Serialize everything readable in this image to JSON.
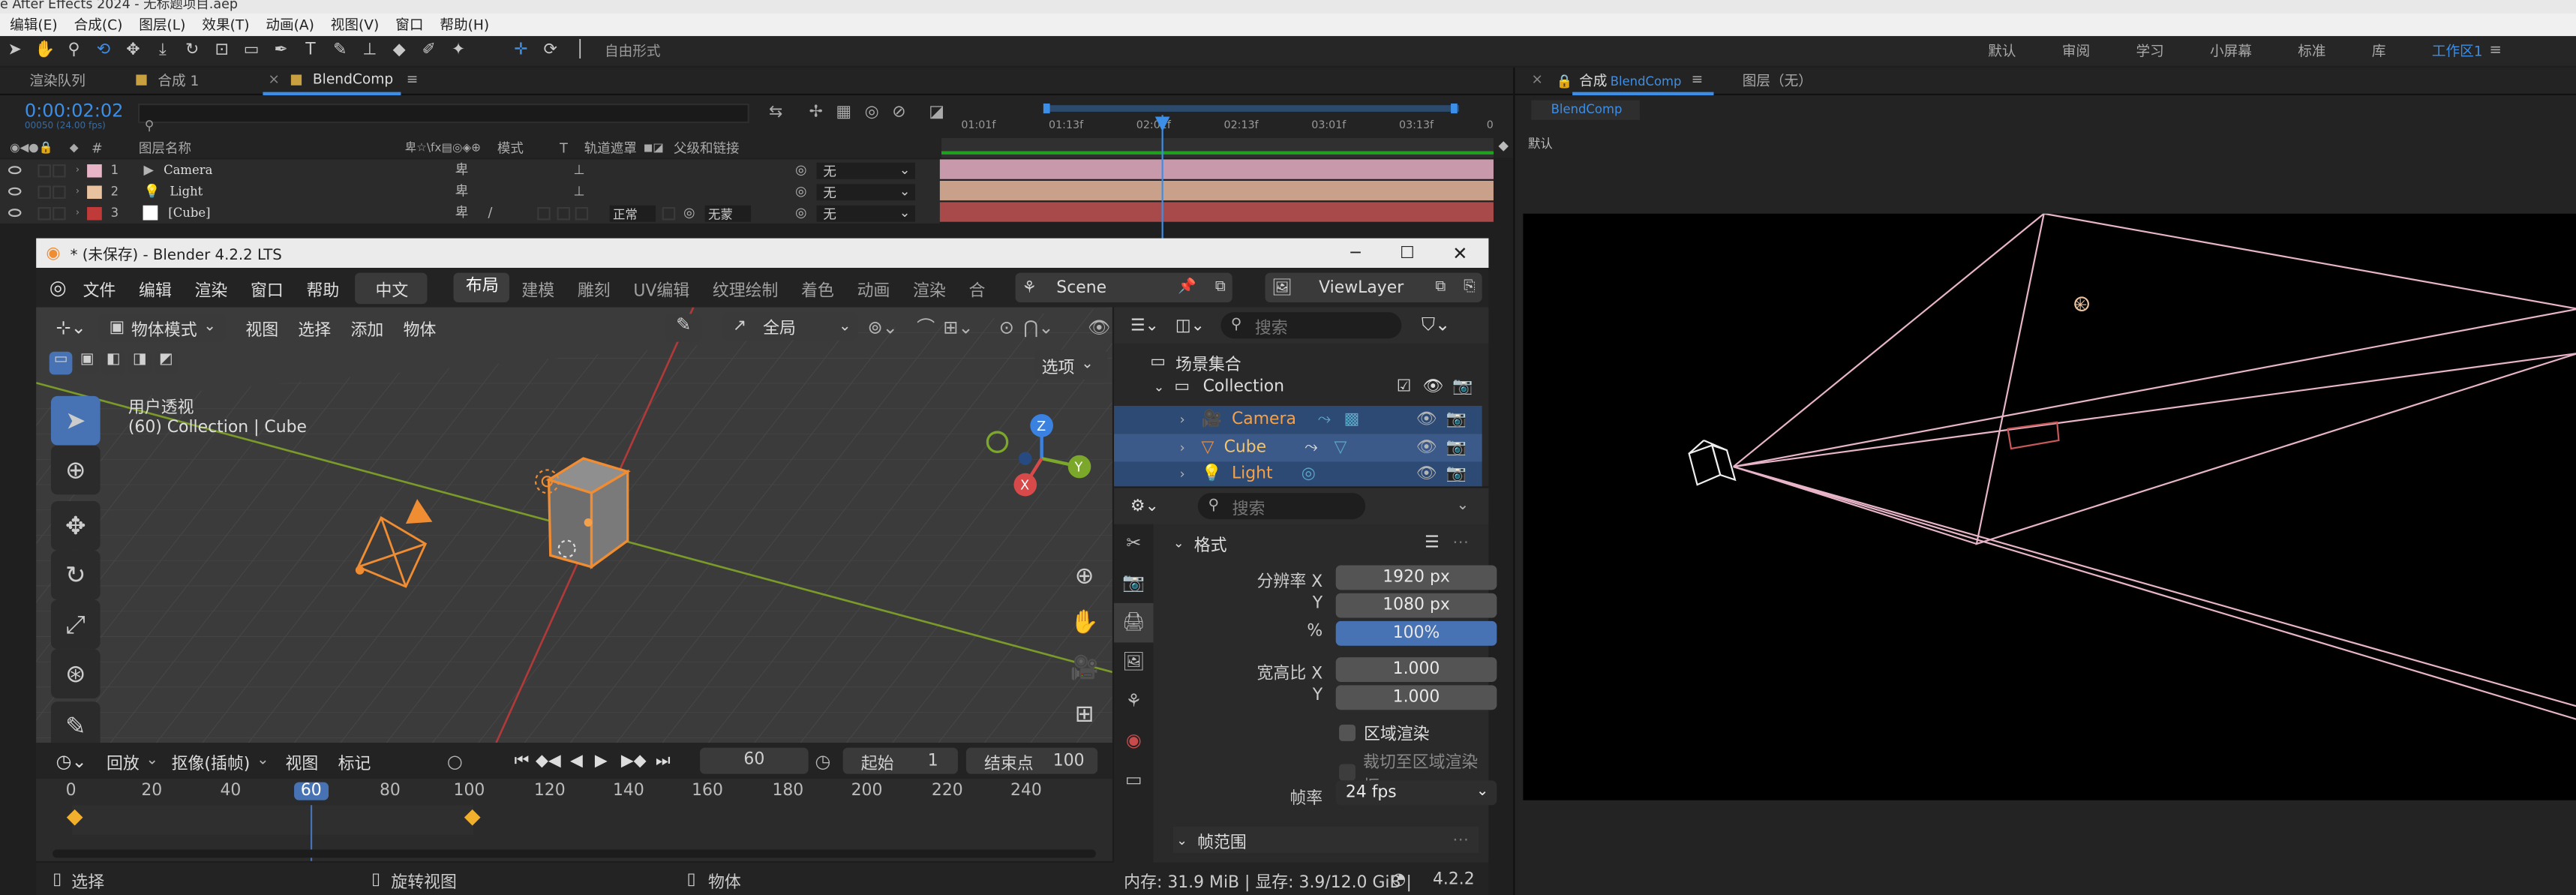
{
  "ae": {
    "title": "e After Effects 2024 - 无标题项目.aep",
    "menu": [
      "编辑(E)",
      "合成(C)",
      "图层(L)",
      "效果(T)",
      "动画(A)",
      "视图(V)",
      "窗口",
      "帮助(H)"
    ],
    "freeform": "自由形式",
    "workspaces": [
      "默认",
      "审阅",
      "学习",
      "小屏幕",
      "标准",
      "库",
      "工作区1"
    ],
    "panels": {
      "render_queue": "渲染队列",
      "comp1": "合成 1",
      "blendcomp_tab": "BlendComp",
      "comp_viewer": "合成",
      "comp_viewer_name": "BlendComp",
      "layer_panel": "图层（无）",
      "viewer_label": "BlendComp",
      "default_label": "默认"
    },
    "timecode": "0:00:02:02",
    "timecode_sub": "00050 (24.00 fps)",
    "columns": {
      "layer_name": "图层名称",
      "mode": "模式",
      "t": "T",
      "track_matte": "轨道遮罩",
      "parent": "父级和链接"
    },
    "layers": [
      {
        "num": "1",
        "name": "Camera",
        "parent": "无",
        "color": "#e8b4c8",
        "mode": "",
        "matte": ""
      },
      {
        "num": "2",
        "name": "Light",
        "parent": "无",
        "color": "#e9c2a0",
        "mode": "",
        "matte": ""
      },
      {
        "num": "3",
        "name": "[Cube]",
        "parent": "无",
        "color": "#c03a3a",
        "mode": "正常",
        "matte": "无蒙"
      }
    ],
    "ruler": [
      "01:01f",
      "01:13f",
      "02:01f",
      "02:13f",
      "03:01f",
      "03:13f",
      "0"
    ],
    "colors": {
      "accent": "#3c8ee6",
      "track_pink": "#c899aa",
      "track_peach": "#c9a08a",
      "track_red": "#a94a4a"
    }
  },
  "blender": {
    "title": "* (未保存) - Blender 4.2.2 LTS",
    "menu": [
      "文件",
      "编辑",
      "渲染",
      "窗口",
      "帮助"
    ],
    "lang": "中文",
    "workspaces": [
      "布局",
      "建模",
      "雕刻",
      "UV编辑",
      "纹理绘制",
      "着色",
      "动画",
      "渲染",
      "合"
    ],
    "scene": "Scene",
    "viewlayer": "ViewLayer",
    "header": {
      "mode": "物体模式",
      "view": "视图",
      "select": "选择",
      "add": "添加",
      "object": "物体",
      "transform": "全局",
      "options": "选项"
    },
    "viewport": {
      "persp": "用户透视",
      "context": "(60) Collection | Cube"
    },
    "outliner": {
      "search": "搜索",
      "root": "场景集合",
      "collection": "Collection",
      "items": [
        "Camera",
        "Cube",
        "Light"
      ]
    },
    "props": {
      "search": "搜索",
      "format": "格式",
      "res_x_label": "分辨率 X",
      "res_x": "1920 px",
      "res_y_label": "Y",
      "res_y": "1080 px",
      "pct_label": "%",
      "pct": "100%",
      "aspect_x_label": "宽高比 X",
      "aspect_x": "1.000",
      "aspect_y_label": "Y",
      "aspect_y": "1.000",
      "region": "区域渲染",
      "crop": "裁切至区域渲染框",
      "fps_label": "帧率",
      "fps": "24 fps",
      "frame_range": "帧范围"
    },
    "timeline": {
      "playback": "回放",
      "keying": "抠像(插帧)",
      "view": "视图",
      "marker": "标记",
      "frame": "60",
      "start_label": "起始",
      "start": "1",
      "end_label": "结束点",
      "end": "100",
      "ticks": [
        "0",
        "20",
        "40",
        "60",
        "80",
        "100",
        "120",
        "140",
        "160",
        "180",
        "200",
        "220",
        "240"
      ]
    },
    "status": {
      "select": "选择",
      "rotate": "旋转视图",
      "object": "物体",
      "mem": "内存: 31.9 MiB | 显存: 3.9/12.0 GiB |",
      "version": "4.2.2"
    },
    "colors": {
      "active_blue": "#4772b3",
      "orange": "#f08c32"
    }
  }
}
